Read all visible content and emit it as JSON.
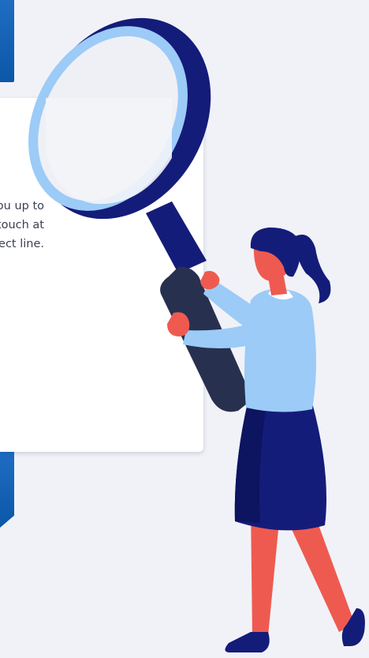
{
  "card": {
    "lines": [
      "o keep you up to",
      "e get in touch at",
      "e subject line."
    ]
  },
  "colors": {
    "background": "#f1f2f7",
    "accent_blue": "#1565c0",
    "navy": "#141c7a",
    "light_blue": "#9ccbf7",
    "coral": "#ef5a50",
    "dark_handle": "#283050"
  },
  "illustration": {
    "icon": "magnifying-glass-icon",
    "figure": "woman-holding-magnifier"
  }
}
